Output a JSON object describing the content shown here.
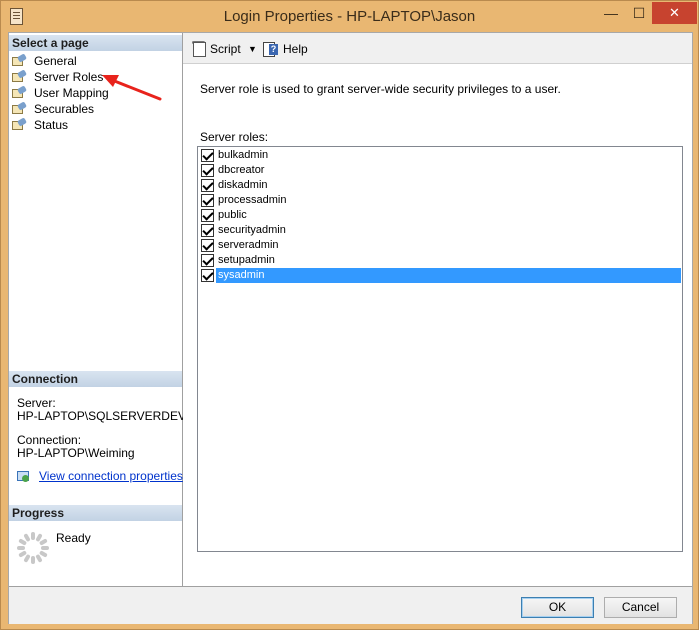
{
  "window": {
    "title": "Login Properties - HP-LAPTOP\\Jason",
    "minimize": "—",
    "maximize": "☐",
    "close": "✕"
  },
  "select_page": {
    "header": "Select a page",
    "items": [
      "General",
      "Server Roles",
      "User Mapping",
      "Securables",
      "Status"
    ]
  },
  "connection": {
    "header": "Connection",
    "server_label": "Server:",
    "server_value": "HP-LAPTOP\\SQLSERVERDEV",
    "connection_label": "Connection:",
    "connection_value": "HP-LAPTOP\\Weiming",
    "link": "View connection properties"
  },
  "progress": {
    "header": "Progress",
    "status": "Ready"
  },
  "toolbar": {
    "script": "Script",
    "help": "Help"
  },
  "main": {
    "description": "Server role is used to grant server-wide security privileges to a user.",
    "roles_label": "Server roles:",
    "roles": [
      {
        "name": "bulkadmin",
        "checked": true
      },
      {
        "name": "dbcreator",
        "checked": true
      },
      {
        "name": "diskadmin",
        "checked": true
      },
      {
        "name": "processadmin",
        "checked": true
      },
      {
        "name": "public",
        "checked": true
      },
      {
        "name": "securityadmin",
        "checked": true
      },
      {
        "name": "serveradmin",
        "checked": true
      },
      {
        "name": "setupadmin",
        "checked": true
      },
      {
        "name": "sysadmin",
        "checked": true,
        "selected": true
      }
    ]
  },
  "buttons": {
    "ok": "OK",
    "cancel": "Cancel"
  },
  "colors": {
    "titlebar": "#e9b772",
    "selection": "#3399ff",
    "annotation_arrow": "#e8231c"
  }
}
